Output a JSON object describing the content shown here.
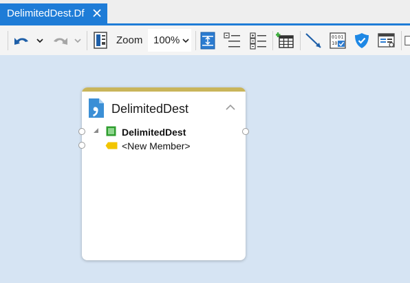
{
  "tab": {
    "title": "DelimitedDest.Df"
  },
  "toolbar": {
    "zoom_label": "Zoom",
    "zoom_value": "100%",
    "icons": [
      "undo-icon",
      "undo-dropdown-icon",
      "redo-icon",
      "redo-dropdown-icon",
      "page-layout-icon",
      "fit-to-page-icon",
      "collapse-members-icon",
      "expand-members-icon",
      "add-entity-icon",
      "add-relation-icon",
      "data-format-icon",
      "security-shield-icon",
      "properties-window-icon"
    ]
  },
  "node": {
    "title": "DelimitedDest",
    "entity": "DelimitedDest",
    "new_member": "<New Member>"
  },
  "colors": {
    "accent": "#1e7cd7",
    "canvas": "#d6e4f3",
    "node_header": "#c9b55a",
    "entity_icon": "#3cae3c",
    "member_icon": "#f2c500"
  }
}
